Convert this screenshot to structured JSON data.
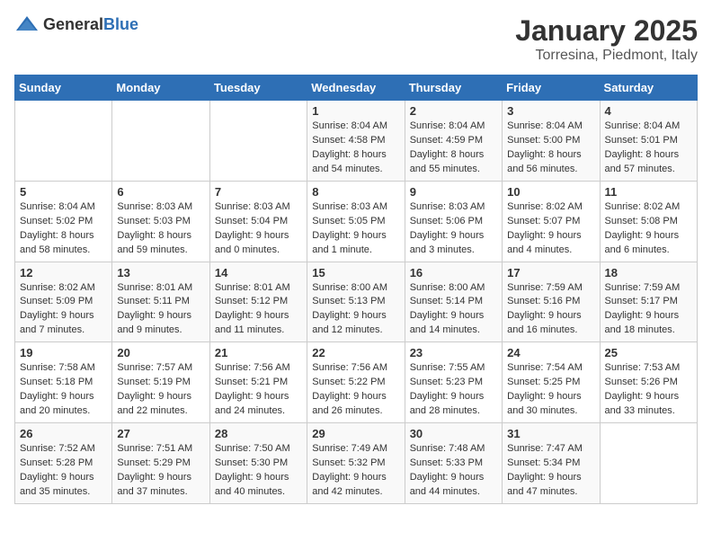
{
  "logo": {
    "general": "General",
    "blue": "Blue"
  },
  "title": "January 2025",
  "location": "Torresina, Piedmont, Italy",
  "headers": [
    "Sunday",
    "Monday",
    "Tuesday",
    "Wednesday",
    "Thursday",
    "Friday",
    "Saturday"
  ],
  "weeks": [
    [
      {
        "day": "",
        "info": ""
      },
      {
        "day": "",
        "info": ""
      },
      {
        "day": "",
        "info": ""
      },
      {
        "day": "1",
        "info": "Sunrise: 8:04 AM\nSunset: 4:58 PM\nDaylight: 8 hours\nand 54 minutes."
      },
      {
        "day": "2",
        "info": "Sunrise: 8:04 AM\nSunset: 4:59 PM\nDaylight: 8 hours\nand 55 minutes."
      },
      {
        "day": "3",
        "info": "Sunrise: 8:04 AM\nSunset: 5:00 PM\nDaylight: 8 hours\nand 56 minutes."
      },
      {
        "day": "4",
        "info": "Sunrise: 8:04 AM\nSunset: 5:01 PM\nDaylight: 8 hours\nand 57 minutes."
      }
    ],
    [
      {
        "day": "5",
        "info": "Sunrise: 8:04 AM\nSunset: 5:02 PM\nDaylight: 8 hours\nand 58 minutes."
      },
      {
        "day": "6",
        "info": "Sunrise: 8:03 AM\nSunset: 5:03 PM\nDaylight: 8 hours\nand 59 minutes."
      },
      {
        "day": "7",
        "info": "Sunrise: 8:03 AM\nSunset: 5:04 PM\nDaylight: 9 hours\nand 0 minutes."
      },
      {
        "day": "8",
        "info": "Sunrise: 8:03 AM\nSunset: 5:05 PM\nDaylight: 9 hours\nand 1 minute."
      },
      {
        "day": "9",
        "info": "Sunrise: 8:03 AM\nSunset: 5:06 PM\nDaylight: 9 hours\nand 3 minutes."
      },
      {
        "day": "10",
        "info": "Sunrise: 8:02 AM\nSunset: 5:07 PM\nDaylight: 9 hours\nand 4 minutes."
      },
      {
        "day": "11",
        "info": "Sunrise: 8:02 AM\nSunset: 5:08 PM\nDaylight: 9 hours\nand 6 minutes."
      }
    ],
    [
      {
        "day": "12",
        "info": "Sunrise: 8:02 AM\nSunset: 5:09 PM\nDaylight: 9 hours\nand 7 minutes."
      },
      {
        "day": "13",
        "info": "Sunrise: 8:01 AM\nSunset: 5:11 PM\nDaylight: 9 hours\nand 9 minutes."
      },
      {
        "day": "14",
        "info": "Sunrise: 8:01 AM\nSunset: 5:12 PM\nDaylight: 9 hours\nand 11 minutes."
      },
      {
        "day": "15",
        "info": "Sunrise: 8:00 AM\nSunset: 5:13 PM\nDaylight: 9 hours\nand 12 minutes."
      },
      {
        "day": "16",
        "info": "Sunrise: 8:00 AM\nSunset: 5:14 PM\nDaylight: 9 hours\nand 14 minutes."
      },
      {
        "day": "17",
        "info": "Sunrise: 7:59 AM\nSunset: 5:16 PM\nDaylight: 9 hours\nand 16 minutes."
      },
      {
        "day": "18",
        "info": "Sunrise: 7:59 AM\nSunset: 5:17 PM\nDaylight: 9 hours\nand 18 minutes."
      }
    ],
    [
      {
        "day": "19",
        "info": "Sunrise: 7:58 AM\nSunset: 5:18 PM\nDaylight: 9 hours\nand 20 minutes."
      },
      {
        "day": "20",
        "info": "Sunrise: 7:57 AM\nSunset: 5:19 PM\nDaylight: 9 hours\nand 22 minutes."
      },
      {
        "day": "21",
        "info": "Sunrise: 7:56 AM\nSunset: 5:21 PM\nDaylight: 9 hours\nand 24 minutes."
      },
      {
        "day": "22",
        "info": "Sunrise: 7:56 AM\nSunset: 5:22 PM\nDaylight: 9 hours\nand 26 minutes."
      },
      {
        "day": "23",
        "info": "Sunrise: 7:55 AM\nSunset: 5:23 PM\nDaylight: 9 hours\nand 28 minutes."
      },
      {
        "day": "24",
        "info": "Sunrise: 7:54 AM\nSunset: 5:25 PM\nDaylight: 9 hours\nand 30 minutes."
      },
      {
        "day": "25",
        "info": "Sunrise: 7:53 AM\nSunset: 5:26 PM\nDaylight: 9 hours\nand 33 minutes."
      }
    ],
    [
      {
        "day": "26",
        "info": "Sunrise: 7:52 AM\nSunset: 5:28 PM\nDaylight: 9 hours\nand 35 minutes."
      },
      {
        "day": "27",
        "info": "Sunrise: 7:51 AM\nSunset: 5:29 PM\nDaylight: 9 hours\nand 37 minutes."
      },
      {
        "day": "28",
        "info": "Sunrise: 7:50 AM\nSunset: 5:30 PM\nDaylight: 9 hours\nand 40 minutes."
      },
      {
        "day": "29",
        "info": "Sunrise: 7:49 AM\nSunset: 5:32 PM\nDaylight: 9 hours\nand 42 minutes."
      },
      {
        "day": "30",
        "info": "Sunrise: 7:48 AM\nSunset: 5:33 PM\nDaylight: 9 hours\nand 44 minutes."
      },
      {
        "day": "31",
        "info": "Sunrise: 7:47 AM\nSunset: 5:34 PM\nDaylight: 9 hours\nand 47 minutes."
      },
      {
        "day": "",
        "info": ""
      }
    ]
  ]
}
